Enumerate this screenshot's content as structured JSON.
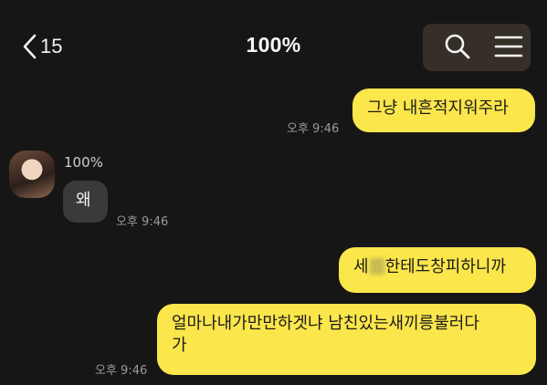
{
  "header": {
    "back_count": "15",
    "title": "100%"
  },
  "messages": {
    "m1": {
      "text": "그냥 내흔적지워주라",
      "time": "오후 9:46"
    },
    "incoming": {
      "sender": "100%",
      "text": "왜",
      "time": "오후 9:46"
    },
    "m2": {
      "text_before": "세",
      "text_after": "한테도창피하니까"
    },
    "m3": {
      "line1": "얼마나내가만만하겟냐 남친있는새끼릉불러다",
      "line2": "가",
      "time": "오후 9:46"
    }
  },
  "colors": {
    "background": "#161616",
    "outgoing_bubble": "#fbe64b",
    "incoming_bubble": "#3a3a3a",
    "time_text": "#9a9a9a"
  }
}
